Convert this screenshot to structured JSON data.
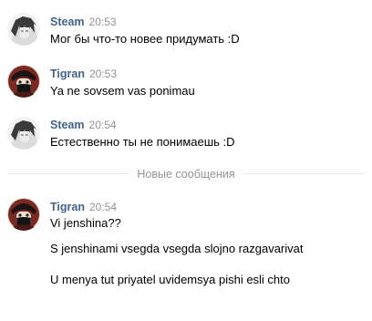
{
  "messages": [
    {
      "author": "Steam",
      "time": "20:53",
      "lines": [
        "Мог бы что-то новее придумать :D"
      ]
    },
    {
      "author": "Tigran",
      "time": "20:53",
      "lines": [
        "Ya ne sovsem vas ponimau"
      ]
    },
    {
      "author": "Steam",
      "time": "20:54",
      "lines": [
        "Естественно ты не понимаешь :D"
      ]
    }
  ],
  "divider": {
    "label": "Новые сообщения"
  },
  "new_messages": [
    {
      "author": "Tigran",
      "time": "20:54",
      "lines": [
        "Vi jenshina??",
        "S jenshinami vsegda vsegda slojno razgavarivat",
        "U menya tut priyatel uvidemsya pishi esli chto"
      ]
    }
  ],
  "icons": {
    "steam_avatar": "anime-character-avatar",
    "tigran_avatar": "masked-character-avatar"
  },
  "colors": {
    "author": "#42648b",
    "time": "#939393",
    "divider_line": "#e7e8ec",
    "text": "#000000"
  }
}
